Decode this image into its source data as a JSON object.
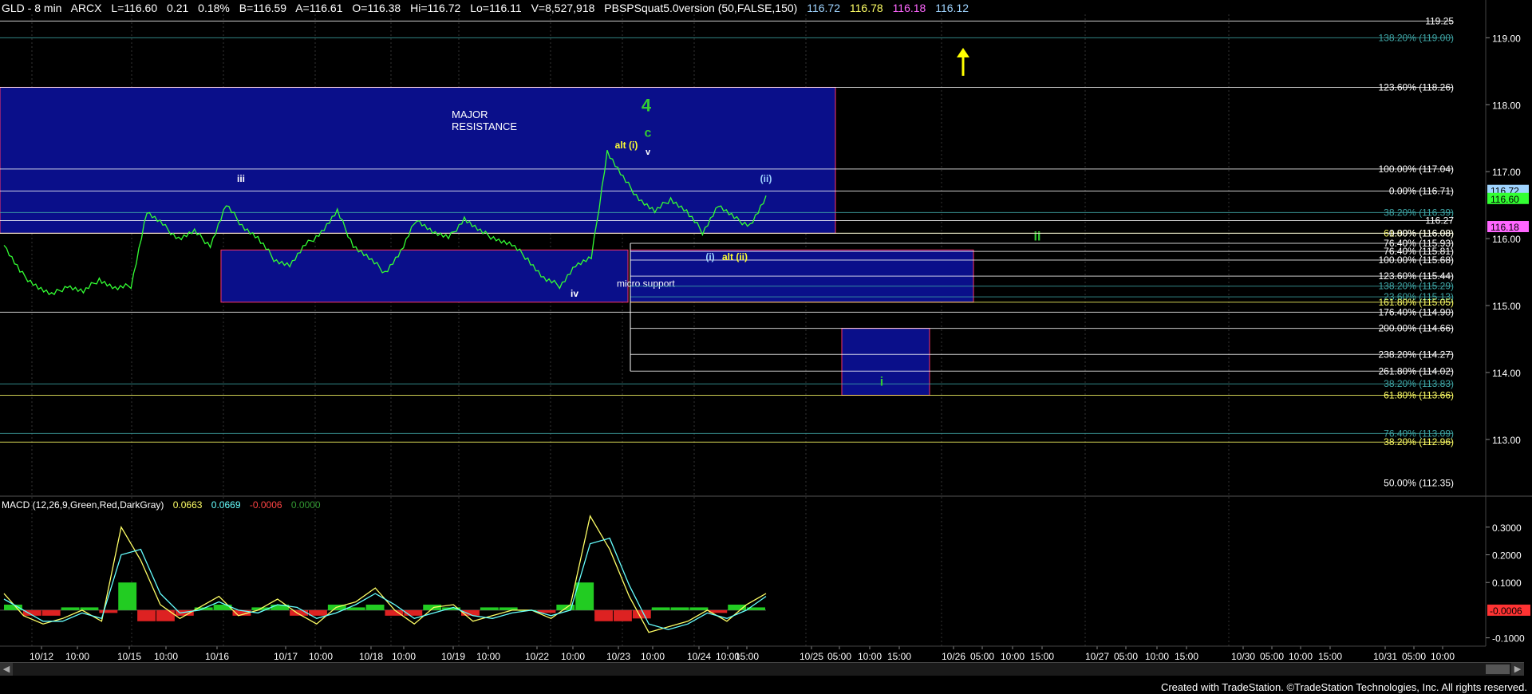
{
  "header": {
    "symbol": "GLD - 8 min",
    "exchange": "ARCX",
    "last": "L=116.60",
    "change": "0.21",
    "change_pct": "0.18%",
    "bid": "B=116.59",
    "ask": "A=116.61",
    "open": "O=116.38",
    "high": "Hi=116.72",
    "low": "Lo=116.11",
    "volume": "V=8,527,918",
    "indicator": "PBSPSquat5.0version (50,FALSE,150)",
    "ind_values": [
      "116.72",
      "116.78",
      "116.18",
      "116.12"
    ],
    "ind_colors": [
      "#9fd4ff",
      "#ffff66",
      "#ff66ff",
      "#9fd4ff"
    ]
  },
  "macd_header": {
    "label": "MACD (12,26,9,Green,Red,DarkGray)",
    "values": [
      "0.0663",
      "0.0669",
      "-0.0006",
      "0.0000"
    ],
    "colors": [
      "#ffff66",
      "#66ffff",
      "#ff4444",
      "#339933"
    ]
  },
  "chart_data": {
    "type": "line",
    "title": "GLD - 8 min",
    "price_ticks": [
      "119.00",
      "118.00",
      "117.00",
      "116.00",
      "115.00",
      "114.00",
      "113.00"
    ],
    "price_ylim": [
      112.2,
      119.35
    ],
    "price_labels": [
      {
        "value": 116.72,
        "text": "116.72",
        "bg": "#9fd4ff",
        "fg": "#000"
      },
      {
        "value": 116.6,
        "text": "116.60",
        "bg": "#33ff33",
        "fg": "#000"
      },
      {
        "value": 116.18,
        "text": "116.18",
        "bg": "#ff66ff",
        "fg": "#000"
      }
    ],
    "macd_ticks": [
      "0.3000",
      "0.2000",
      "0.1000",
      "-0.1000"
    ],
    "macd_ylim": [
      -0.13,
      0.36
    ],
    "macd_current": "-0.0006",
    "x_ticks": [
      "10/12",
      "10:00",
      "10/15",
      "10:00",
      "10/16",
      "10/17",
      "10:00",
      "10/18",
      "10:00",
      "10/19",
      "10:00",
      "10/22",
      "10:00",
      "10/23",
      "10:00",
      "10/24",
      "10:00",
      "15:00",
      "10/25",
      "05:00",
      "10:00",
      "15:00",
      "10/26",
      "05:00",
      "10:00",
      "15:00",
      "10/27",
      "05:00",
      "10:00",
      "15:00",
      "10/30",
      "05:00",
      "10:00",
      "15:00",
      "10/31",
      "05:00",
      "10:00"
    ],
    "fib_levels": [
      {
        "value": 119.25,
        "text": "119.25",
        "color": "#ffffff"
      },
      {
        "value": 119.0,
        "text": "138.20% (119.00)",
        "color": "#3fa7a7"
      },
      {
        "value": 118.26,
        "text": "123.60% (118.26)",
        "color": "#ffffff"
      },
      {
        "value": 117.04,
        "text": "100.00% (117.04)",
        "color": "#ffffff"
      },
      {
        "value": 116.71,
        "text": "0.00% (116.71)",
        "color": "#ffffff"
      },
      {
        "value": 116.39,
        "text": "38.20% (116.39)",
        "color": "#3fa7a7"
      },
      {
        "value": 116.27,
        "text": "116.27",
        "color": "#ffffff"
      },
      {
        "value": 116.08,
        "text": "61.80% (116.08)",
        "color": "#ffff66"
      },
      {
        "value": 116.08,
        "text": "0.00% (116.08)",
        "color": "#ffffff"
      },
      {
        "value": 115.93,
        "text": "76.40% (115.93)",
        "color": "#ffffff"
      },
      {
        "value": 115.81,
        "text": "76.40% (115.81)",
        "color": "#ffffff"
      },
      {
        "value": 115.68,
        "text": "100.00% (115.68)",
        "color": "#ffffff"
      },
      {
        "value": 115.44,
        "text": "123.60% (115.44)",
        "color": "#ffffff"
      },
      {
        "value": 115.29,
        "text": "138.20% (115.29)",
        "color": "#3fa7a7"
      },
      {
        "value": 115.13,
        "text": "23.60% (115.13)",
        "color": "#3fa7a7"
      },
      {
        "value": 115.05,
        "text": "161.80% (115.05)",
        "color": "#ffff66"
      },
      {
        "value": 114.9,
        "text": "176.40% (114.90)",
        "color": "#ffffff"
      },
      {
        "value": 114.66,
        "text": "200.00% (114.66)",
        "color": "#ffffff"
      },
      {
        "value": 114.27,
        "text": "238.20% (114.27)",
        "color": "#ffffff"
      },
      {
        "value": 114.02,
        "text": "261.80% (114.02)",
        "color": "#ffffff"
      },
      {
        "value": 113.83,
        "text": "38.20% (113.83)",
        "color": "#3fa7a7"
      },
      {
        "value": 113.66,
        "text": "61.80% (113.66)",
        "color": "#ffff66"
      },
      {
        "value": 113.09,
        "text": "76.40% (113.09)",
        "color": "#3fa7a7"
      },
      {
        "value": 112.96,
        "text": "38.20% (112.96)",
        "color": "#ffff66"
      },
      {
        "value": 112.35,
        "text": "50.00% (112.35)",
        "color": "#ffffff"
      }
    ],
    "zones": [
      {
        "name": "major-resistance-zone",
        "top": 118.26,
        "bottom": 116.08,
        "border": "#ff3366",
        "label": "MAJOR\nRESISTANCE"
      },
      {
        "name": "micro-support-zone",
        "top": 115.83,
        "bottom": 115.05,
        "border": "#ff3366",
        "label": "micro support"
      },
      {
        "name": "wave-i-target-zone",
        "top": 114.66,
        "bottom": 113.66,
        "border": "#ff3366",
        "label": ""
      }
    ],
    "annotations": [
      {
        "text": "4",
        "color": "#33cc33"
      },
      {
        "text": "c",
        "color": "#33cc33"
      },
      {
        "text": "alt (i)",
        "color": "#ffff33"
      },
      {
        "text": "v",
        "color": "#ffffff"
      },
      {
        "text": "iii",
        "color": "#ffffff"
      },
      {
        "text": "(ii)",
        "color": "#9fd4ff"
      },
      {
        "text": "(i)",
        "color": "#9fd4ff"
      },
      {
        "text": "alt (ii)",
        "color": "#ffff33"
      },
      {
        "text": "iv",
        "color": "#ffffff"
      },
      {
        "text": "ii",
        "color": "#33cc33"
      },
      {
        "text": "i",
        "color": "#33cc33"
      }
    ],
    "price_series": {
      "name": "GLD",
      "values": [
        115.9,
        115.5,
        115.3,
        115.15,
        115.3,
        115.2,
        115.4,
        115.25,
        115.3,
        116.4,
        116.2,
        116.0,
        116.1,
        115.9,
        116.5,
        116.2,
        116.0,
        115.7,
        115.6,
        115.9,
        116.1,
        116.4,
        115.9,
        115.7,
        115.5,
        115.8,
        116.3,
        116.1,
        116.0,
        116.3,
        116.1,
        116.0,
        115.9,
        115.7,
        115.4,
        115.3,
        115.6,
        115.7,
        117.3,
        116.9,
        116.6,
        116.4,
        116.6,
        116.4,
        116.1,
        116.5,
        116.3,
        116.2,
        116.6
      ]
    },
    "macd_series": [
      {
        "name": "MACD",
        "color": "#ffff66",
        "values": [
          0.06,
          -0.02,
          -0.05,
          -0.03,
          0.0,
          -0.04,
          0.3,
          0.18,
          0.02,
          -0.03,
          0.01,
          0.05,
          -0.02,
          0.0,
          0.04,
          -0.01,
          -0.05,
          0.01,
          0.03,
          0.08,
          0.0,
          -0.05,
          0.01,
          0.02,
          -0.04,
          -0.02,
          0.0,
          0.0,
          -0.03,
          0.02,
          0.34,
          0.22,
          0.05,
          -0.08,
          -0.06,
          -0.04,
          0.0,
          -0.04,
          0.02,
          0.06
        ]
      },
      {
        "name": "Signal",
        "color": "#66ffff",
        "values": [
          0.04,
          0.0,
          -0.04,
          -0.04,
          -0.01,
          -0.03,
          0.2,
          0.22,
          0.06,
          -0.01,
          0.0,
          0.03,
          0.0,
          -0.01,
          0.02,
          0.01,
          -0.03,
          -0.01,
          0.02,
          0.06,
          0.02,
          -0.03,
          -0.01,
          0.01,
          -0.02,
          -0.03,
          -0.01,
          0.0,
          -0.02,
          0.0,
          0.24,
          0.26,
          0.09,
          -0.05,
          -0.07,
          -0.05,
          -0.01,
          -0.03,
          0.0,
          0.05
        ]
      }
    ],
    "macd_hist": [
      0.02,
      -0.02,
      -0.02,
      0.01,
      0.01,
      -0.01,
      0.1,
      -0.04,
      -0.04,
      -0.02,
      0.01,
      0.02,
      -0.02,
      0.01,
      0.02,
      -0.02,
      -0.02,
      0.02,
      0.01,
      0.02,
      -0.02,
      -0.02,
      0.02,
      0.01,
      -0.02,
      0.01,
      0.01,
      0.0,
      -0.01,
      0.02,
      0.1,
      -0.04,
      -0.04,
      -0.03,
      0.01,
      0.01,
      0.01,
      -0.01,
      0.02,
      0.01
    ]
  },
  "footer": "Created with TradeStation. ©TradeStation Technologies, Inc. All rights reserved."
}
